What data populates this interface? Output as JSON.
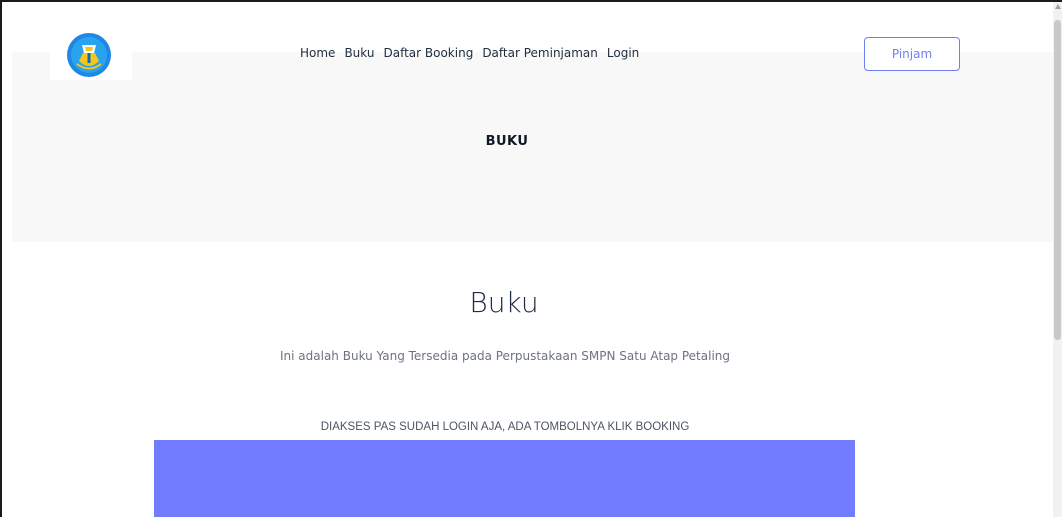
{
  "nav": {
    "items": [
      "Home",
      "Buku",
      "Daftar Booking",
      "Daftar Peminjaman",
      "Login"
    ],
    "cta_label": "Pinjam"
  },
  "hero": {
    "title": "BUKU"
  },
  "section": {
    "title": "Buku",
    "description": "Ini adalah Buku Yang Tersedia pada Perpustakaan SMPN Satu Atap Petaling",
    "notice": "DIAKSES PAS SUDAH LOGIN AJA, ADA TOMBOLNYA KLIK BOOKING"
  },
  "colors": {
    "accent": "#717cff",
    "hero_background": "#f8f8f8",
    "text_dark": "#1f2d3d",
    "text_muted": "#6b7280"
  },
  "icons": {
    "logo": "tut-wuri-handayani-logo-icon"
  }
}
